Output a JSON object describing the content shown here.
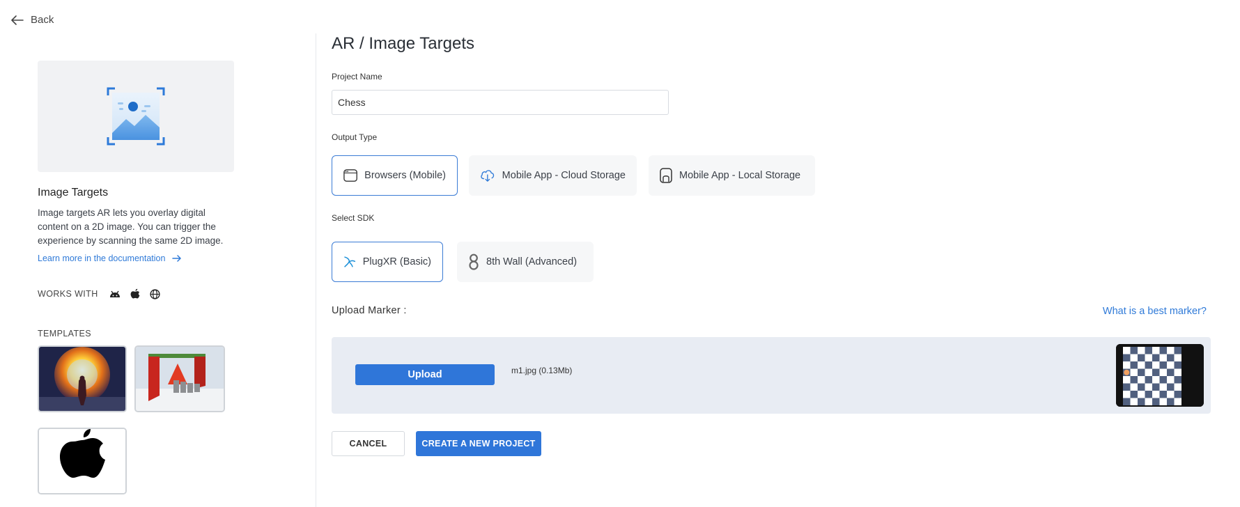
{
  "nav": {
    "back_label": "Back"
  },
  "sidebar": {
    "heading": "Image Targets",
    "description": "Image targets AR lets you overlay digital content on a 2D image. You can trigger the experience by scanning the same 2D image.",
    "learn_more": "Learn more in the documentation",
    "works_with_label": "WORKS WITH",
    "platform_icons": [
      "android-icon",
      "apple-icon",
      "globe-icon"
    ],
    "templates_label": "TEMPLATES",
    "templates": [
      "portal-template",
      "red-structure-template",
      "apple-logo-template"
    ]
  },
  "main": {
    "title": "AR / Image Targets",
    "project_name_label": "Project Name",
    "project_name_value": "Chess",
    "output_type_label": "Output Type",
    "output_types": [
      {
        "label": "Browsers (Mobile)",
        "icon": "browser-icon",
        "selected": true
      },
      {
        "label": "Mobile App - Cloud Storage",
        "icon": "cloud-icon",
        "selected": false
      },
      {
        "label": "Mobile App - Local Storage",
        "icon": "device-icon",
        "selected": false
      }
    ],
    "sdk_label": "Select SDK",
    "sdks": [
      {
        "label": "PlugXR (Basic)",
        "icon": "plugxr-icon",
        "selected": true
      },
      {
        "label": "8th Wall (Advanced)",
        "icon": "eighth-wall-icon",
        "selected": false
      }
    ],
    "upload_label": "Upload Marker :",
    "best_marker_link": "What is a best marker?",
    "upload_button": "Upload",
    "file_info": "m1.jpg (0.13Mb)",
    "cancel_button": "CANCEL",
    "create_button": "CREATE A NEW PROJECT"
  },
  "colors": {
    "accent": "#2f76d9",
    "link": "#2f7ad8",
    "upload_panel": "#e8ecf3",
    "selected_border": "#3a7bd5"
  }
}
